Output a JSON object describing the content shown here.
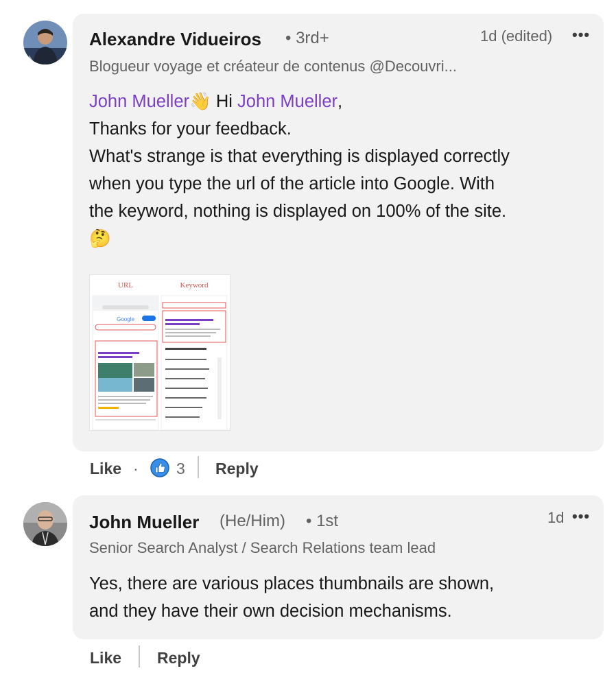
{
  "comments": [
    {
      "author": "Alexandre Vidueiros",
      "connection": "• 3rd+",
      "headline": "Blogueur voyage et créateur de contenus @Decouvri...",
      "timestamp": "1d (edited)",
      "more_icon": "•••",
      "mention_1": "John Mueller",
      "wave_emoji": "👋",
      "greeting": " Hi ",
      "mention_2": "John Mueller",
      "comma": ",",
      "line_1": "Thanks for your feedback.",
      "line_2": "What's strange is that everything is displayed correctly",
      "line_3": "when you type the url of the article into Google. With",
      "line_4": "the keyword, nothing is displayed on 100% of the site.",
      "thinking_emoji": "🤔",
      "attachment": {
        "label_left": "URL",
        "label_right": "Keyword",
        "google_logo": "Google",
        "result_title": "Les calanques de Cassis à pied : Conseils et itinéraire",
        "related_heading": "Recherches associées"
      },
      "actions": {
        "like": "Like",
        "dot": "·",
        "reaction_count": "3",
        "reply": "Reply"
      }
    },
    {
      "author": "John Mueller",
      "pronouns": "(He/Him)",
      "connection": "• 1st",
      "headline": "Senior Search Analyst / Search Relations team lead",
      "timestamp": "1d",
      "more_icon": "•••",
      "line_1": "Yes, there are various places thumbnails are shown,",
      "line_2": "and they have their own decision mechanisms.",
      "actions": {
        "like": "Like",
        "reply": "Reply"
      }
    }
  ],
  "colors": {
    "mention": "#7b3fc4",
    "bubble": "#f2f2f2",
    "like_badge": "#378fe9"
  }
}
